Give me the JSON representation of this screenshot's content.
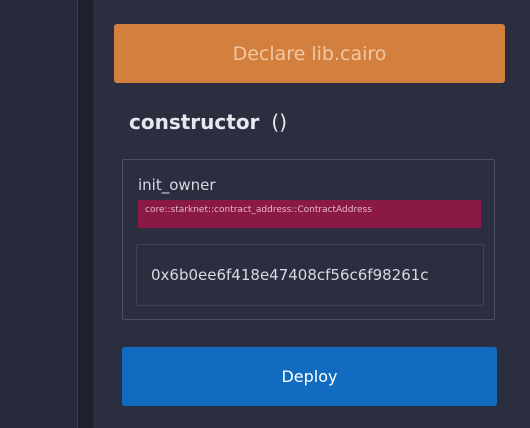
{
  "declare": {
    "label": "Declare lib.cairo"
  },
  "constructor": {
    "title": "constructor",
    "parens": "()"
  },
  "params": [
    {
      "name": "init_owner",
      "type": "core::starknet::contract_address::ContractAddress",
      "value": "0x6b0ee6f418e47408cf56c6f98261c"
    }
  ],
  "deploy": {
    "label": "Deploy"
  },
  "colors": {
    "declare_bg": "#d3803e",
    "type_badge_bg": "#8a1a45",
    "deploy_bg": "#116bc0",
    "panel_bg": "#2a2e3f"
  }
}
